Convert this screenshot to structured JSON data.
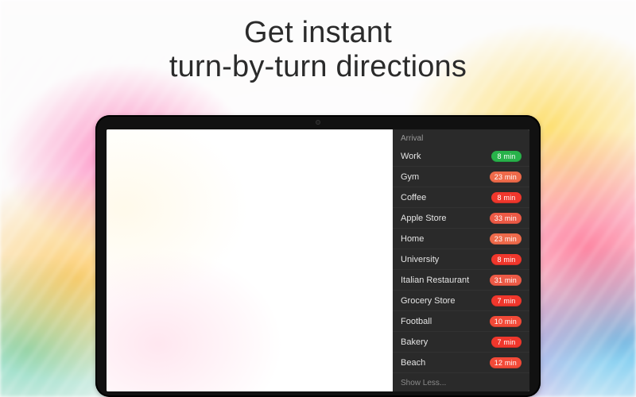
{
  "headline": {
    "line1": "Get instant",
    "line2": "turn-by-turn directions"
  },
  "panel": {
    "header": "Arrival",
    "show_less": "Show Less...",
    "items": [
      {
        "name": "Work",
        "eta_value": 8,
        "eta_unit": "min",
        "badge_color": "#28b24a"
      },
      {
        "name": "Gym",
        "eta_value": 23,
        "eta_unit": "min",
        "badge_color": "#ee6a4a"
      },
      {
        "name": "Coffee",
        "eta_value": 8,
        "eta_unit": "min",
        "badge_color": "#f0372c"
      },
      {
        "name": "Apple Store",
        "eta_value": 33,
        "eta_unit": "min",
        "badge_color": "#ec5a46"
      },
      {
        "name": "Home",
        "eta_value": 23,
        "eta_unit": "min",
        "badge_color": "#ee6a4a"
      },
      {
        "name": "University",
        "eta_value": 8,
        "eta_unit": "min",
        "badge_color": "#f0372c"
      },
      {
        "name": "Italian Restaurant",
        "eta_value": 31,
        "eta_unit": "min",
        "badge_color": "#ec5a46"
      },
      {
        "name": "Grocery Store",
        "eta_value": 7,
        "eta_unit": "min",
        "badge_color": "#f0372c"
      },
      {
        "name": "Football",
        "eta_value": 10,
        "eta_unit": "min",
        "badge_color": "#f24a38"
      },
      {
        "name": "Bakery",
        "eta_value": 7,
        "eta_unit": "min",
        "badge_color": "#f0372c"
      },
      {
        "name": "Beach",
        "eta_value": 12,
        "eta_unit": "min",
        "badge_color": "#f24a38"
      }
    ]
  }
}
